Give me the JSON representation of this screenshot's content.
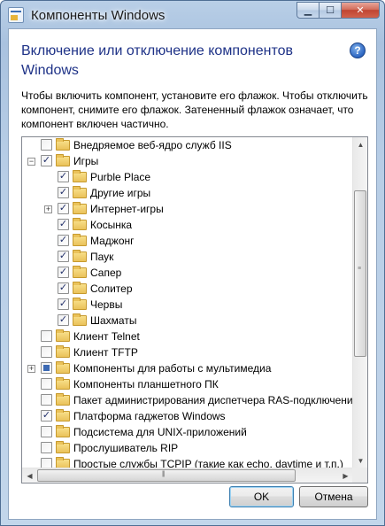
{
  "window": {
    "title": "Компоненты Windows",
    "controls": {
      "minimize_icon": "minimize-icon",
      "maximize_icon": "maximize-icon",
      "close_icon": "close-icon"
    }
  },
  "dialog": {
    "heading": "Включение или отключение компонентов Windows",
    "help_glyph": "?",
    "description": "Чтобы включить компонент, установите его флажок. Чтобы отключить компонент, снимите его флажок. Затененный флажок означает, что компонент включен частично."
  },
  "tree": {
    "items": [
      {
        "label": "Внедряемое веб-ядро служб IIS",
        "level": 0,
        "state": "unchecked",
        "expander": "none"
      },
      {
        "label": "Игры",
        "level": 0,
        "state": "checked",
        "expander": "collapse"
      },
      {
        "label": "Purble Place",
        "level": 1,
        "state": "checked",
        "expander": "none"
      },
      {
        "label": "Другие игры",
        "level": 1,
        "state": "checked",
        "expander": "none"
      },
      {
        "label": "Интернет-игры",
        "level": 1,
        "state": "checked",
        "expander": "expand"
      },
      {
        "label": "Косынка",
        "level": 1,
        "state": "checked",
        "expander": "none"
      },
      {
        "label": "Маджонг",
        "level": 1,
        "state": "checked",
        "expander": "none"
      },
      {
        "label": "Паук",
        "level": 1,
        "state": "checked",
        "expander": "none"
      },
      {
        "label": "Сапер",
        "level": 1,
        "state": "checked",
        "expander": "none"
      },
      {
        "label": "Солитер",
        "level": 1,
        "state": "checked",
        "expander": "none"
      },
      {
        "label": "Червы",
        "level": 1,
        "state": "checked",
        "expander": "none"
      },
      {
        "label": "Шахматы",
        "level": 1,
        "state": "checked",
        "expander": "none"
      },
      {
        "label": "Клиент Telnet",
        "level": 0,
        "state": "unchecked",
        "expander": "none"
      },
      {
        "label": "Клиент TFTP",
        "level": 0,
        "state": "unchecked",
        "expander": "none"
      },
      {
        "label": "Компоненты для работы с мультимедиа",
        "level": 0,
        "state": "partial",
        "expander": "expand"
      },
      {
        "label": "Компоненты планшетного ПК",
        "level": 0,
        "state": "unchecked",
        "expander": "none"
      },
      {
        "label": "Пакет администрирования диспетчера RAS-подключений",
        "level": 0,
        "state": "unchecked",
        "expander": "none"
      },
      {
        "label": "Платформа гаджетов Windows",
        "level": 0,
        "state": "checked",
        "expander": "none"
      },
      {
        "label": "Подсистема для UNIX-приложений",
        "level": 0,
        "state": "unchecked",
        "expander": "none"
      },
      {
        "label": "Прослушиватель RIP",
        "level": 0,
        "state": "unchecked",
        "expander": "none"
      },
      {
        "label": "Простые службы TCPIP (такие как echo, daytime и т.п.)",
        "level": 0,
        "state": "unchecked",
        "expander": "none"
      }
    ]
  },
  "buttons": {
    "ok": "OK",
    "cancel": "Отмена"
  },
  "colors": {
    "heading": "#1e3287",
    "partial_fill": "#3d6ab3"
  }
}
